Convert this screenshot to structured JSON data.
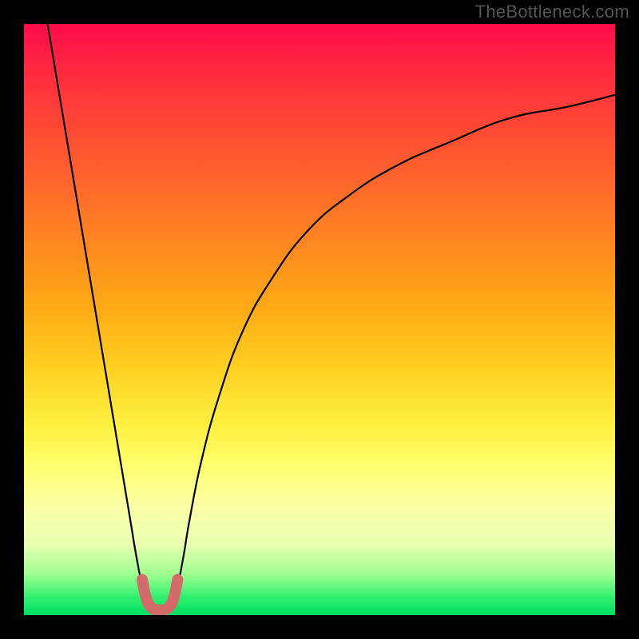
{
  "watermark": "TheBottleneck.com",
  "chart_data": {
    "type": "line",
    "title": "",
    "xlabel": "",
    "ylabel": "",
    "xlim": [
      0,
      100
    ],
    "ylim": [
      0,
      100
    ],
    "grid": false,
    "series": [
      {
        "name": "left-branch",
        "x": [
          4,
          6,
          8,
          10,
          12,
          14,
          16,
          18,
          19,
          20,
          21
        ],
        "y": [
          100,
          88,
          76,
          64,
          52,
          40,
          28,
          16,
          10,
          5,
          2
        ]
      },
      {
        "name": "right-branch",
        "x": [
          25,
          26,
          27,
          28,
          30,
          33,
          37,
          42,
          48,
          55,
          63,
          72,
          82,
          92,
          100
        ],
        "y": [
          2,
          5,
          10,
          16,
          26,
          37,
          48,
          57,
          65,
          71,
          76,
          80,
          84,
          86,
          88
        ]
      },
      {
        "name": "trough-highlight",
        "x": [
          20,
          20.5,
          21,
          21.5,
          22,
          23,
          24,
          24.5,
          25,
          25.5,
          26
        ],
        "y": [
          6,
          3.5,
          2,
          1.3,
          1,
          0.8,
          1,
          1.3,
          2,
          3.5,
          6
        ]
      }
    ],
    "trough_range_x": [
      20,
      26
    ],
    "colors": {
      "curve": "#000000",
      "trough": "#d46a6a"
    }
  }
}
